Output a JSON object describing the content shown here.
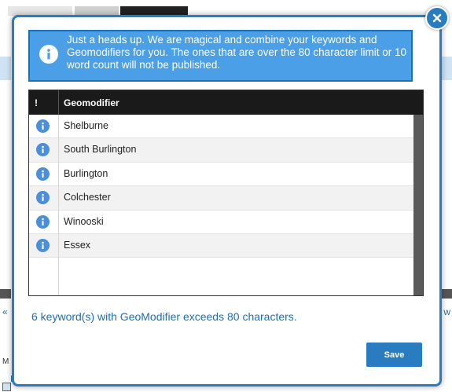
{
  "alert": {
    "text": "Just a heads up. We are magical and combine your keywords and Geomodifiers for you. The ones that are over the 80 character limit or 10 word count will not be published.",
    "icon": "info-icon"
  },
  "table": {
    "columns": [
      "!",
      "Geomodifier"
    ],
    "rows": [
      {
        "icon": "info-icon",
        "geomodifier": "Shelburne"
      },
      {
        "icon": "info-icon",
        "geomodifier": "South Burlington"
      },
      {
        "icon": "info-icon",
        "geomodifier": "Burlington"
      },
      {
        "icon": "info-icon",
        "geomodifier": "Colchester"
      },
      {
        "icon": "info-icon",
        "geomodifier": "Winooski"
      },
      {
        "icon": "info-icon",
        "geomodifier": "Essex"
      }
    ]
  },
  "footer": {
    "warning": "6 keyword(s) with GeoModifier exceeds 80 characters.",
    "save_label": "Save"
  },
  "background": {
    "link_left": "«",
    "link_right": ") w",
    "letter_m": "M"
  },
  "colors": {
    "accent": "#2a7cc0",
    "alert_bg": "#4a9fe6",
    "header_bg": "#1a1a1a",
    "link": "#1a6fb8"
  }
}
